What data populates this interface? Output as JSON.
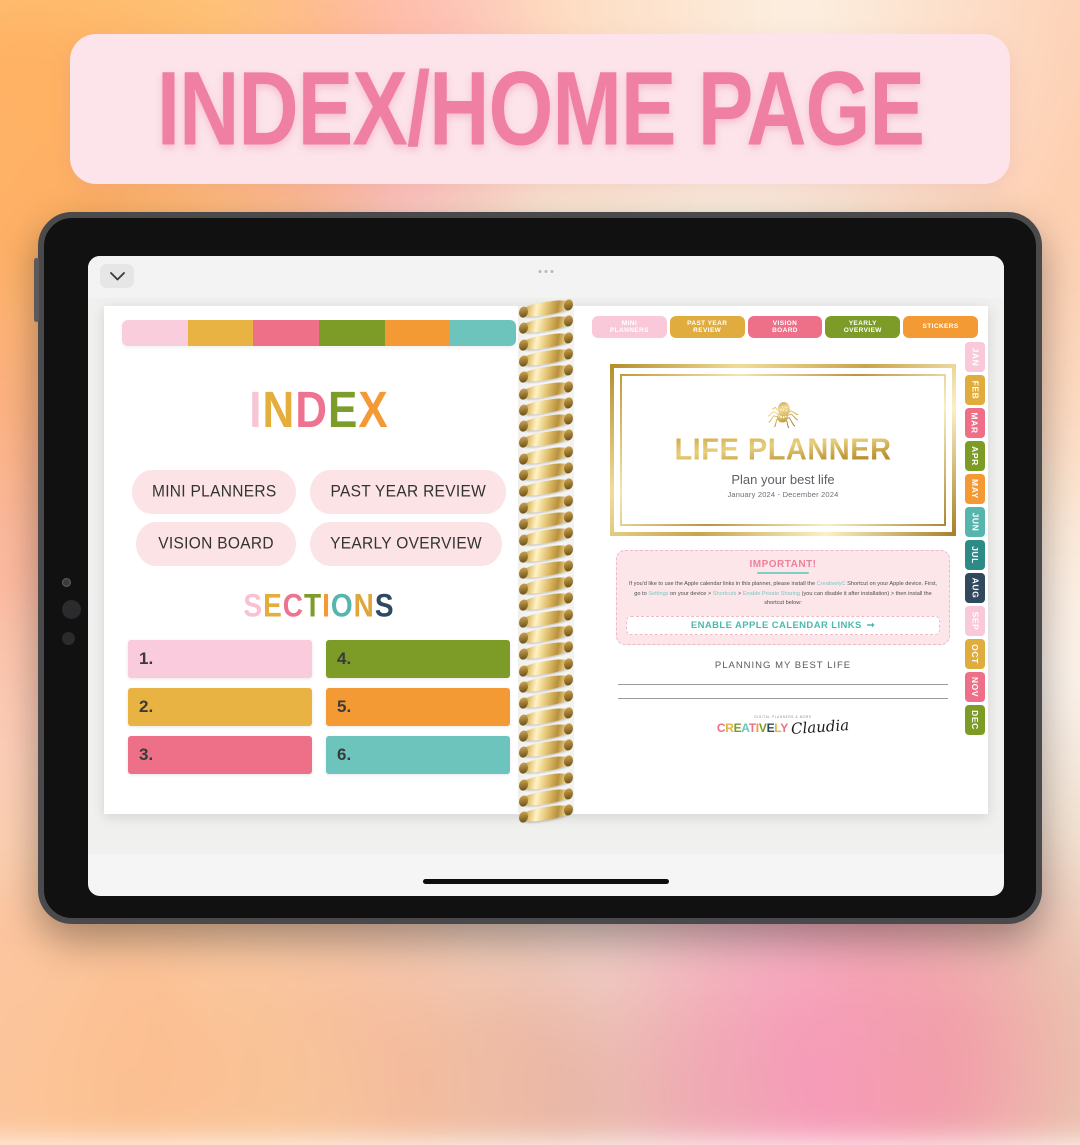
{
  "banner": {
    "title": "INDEX/HOME PAGE",
    "bg_color": "#fce4ea",
    "text_color": "#f07fa4"
  },
  "app_bar": {
    "collapse_icon": "chevron-down-icon",
    "menu_icon": "three-dots-icon"
  },
  "left_page": {
    "color_bar": [
      "#f9cddb",
      "#e8b342",
      "#ee6f88",
      "#7d9c27",
      "#f39a34",
      "#6cc4bd"
    ],
    "index_title": {
      "text": "INDEX",
      "letters": [
        {
          "ch": "I",
          "color": "#f7c6d4"
        },
        {
          "ch": "N",
          "color": "#e4ad3c"
        },
        {
          "ch": "D",
          "color": "#ee7391"
        },
        {
          "ch": "E",
          "color": "#7d9c2a"
        },
        {
          "ch": "X",
          "color": "#f39a34"
        }
      ]
    },
    "index_buttons": [
      {
        "label": "MINI PLANNERS"
      },
      {
        "label": "PAST YEAR REVIEW"
      },
      {
        "label": "VISION BOARD"
      },
      {
        "label": "YEARLY OVERVIEW"
      }
    ],
    "sections_title": {
      "text": "SECTIONS",
      "letters": [
        {
          "ch": "S",
          "color": "#f7c2d1"
        },
        {
          "ch": "E",
          "color": "#e4ad3c"
        },
        {
          "ch": "C",
          "color": "#ee7391"
        },
        {
          "ch": "T",
          "color": "#7d9c2a"
        },
        {
          "ch": "I",
          "color": "#f39a34"
        },
        {
          "ch": "O",
          "color": "#56b6ae"
        },
        {
          "ch": "N",
          "color": "#e0a63a"
        },
        {
          "ch": "S",
          "color": "#30495e"
        }
      ]
    },
    "sections": [
      {
        "number": "1.",
        "color": "#f9cbdd"
      },
      {
        "number": "4.",
        "color": "#7d9c27"
      },
      {
        "number": "2.",
        "color": "#e8b342"
      },
      {
        "number": "5.",
        "color": "#f39a34"
      },
      {
        "number": "3.",
        "color": "#ee6f88"
      },
      {
        "number": "6.",
        "color": "#6cc4bd"
      }
    ]
  },
  "right_page": {
    "top_tabs": [
      {
        "label": "MINI PLANNERS",
        "color": "#f9c9da"
      },
      {
        "label": "PAST YEAR REVIEW",
        "color": "#e0ac3e"
      },
      {
        "label": "VISION BOARD",
        "color": "#ee6f88"
      },
      {
        "label": "YEARLY OVERVIEW",
        "color": "#7d9c27"
      },
      {
        "label": "STICKERS",
        "color": "#f39a34"
      }
    ],
    "cover": {
      "butterfly_icon": "butterfly-icon",
      "title": "LIFE PLANNER",
      "subtitle": "Plan your best life",
      "dates": "January 2024 - December 2024"
    },
    "important": {
      "heading": "IMPORTANT!",
      "body_part_1": "If you'd like to use the Apple calendar links in this planner, please install the ",
      "link_1": "CreativelyC",
      "body_part_2": " Shortcut on your Apple device. First, go to ",
      "link_2": "Settings",
      "body_part_3": " on your device > ",
      "link_3": "Shortcuts",
      "body_part_4": " > ",
      "link_4": "Enable Private Sharing",
      "body_part_5": " (you can disable it after installation) > then install the shortcut below:",
      "button_label": "ENABLE APPLE CALENDAR LINKS",
      "button_icon": "arrow-right-icon"
    },
    "planning_label": "PLANNING MY BEST LIFE",
    "logo": {
      "tagline": "DIGITAL PLANNERS & MORE",
      "word": "CREATIVELY",
      "word_colors": [
        "#ee6f88",
        "#e8b342",
        "#7d9c27",
        "#6cc4bd",
        "#ee6f88",
        "#f39a34",
        "#7d9c27",
        "#30495e",
        "#e8b342",
        "#ee6f88"
      ],
      "script": "Claudia"
    },
    "month_tabs": [
      {
        "label": "JAN",
        "color": "#f9c9da"
      },
      {
        "label": "FEB",
        "color": "#e0ac3e"
      },
      {
        "label": "MAR",
        "color": "#ee6f88"
      },
      {
        "label": "APR",
        "color": "#7d9c27"
      },
      {
        "label": "MAY",
        "color": "#f39a34"
      },
      {
        "label": "JUN",
        "color": "#56b6ae"
      },
      {
        "label": "JUL",
        "color": "#2d8a86"
      },
      {
        "label": "AUG",
        "color": "#30495e"
      },
      {
        "label": "SEP",
        "color": "#f9c9da"
      },
      {
        "label": "OCT",
        "color": "#e0ac3e"
      },
      {
        "label": "NOV",
        "color": "#ee6f88"
      },
      {
        "label": "DEC",
        "color": "#7d9c27"
      }
    ]
  }
}
